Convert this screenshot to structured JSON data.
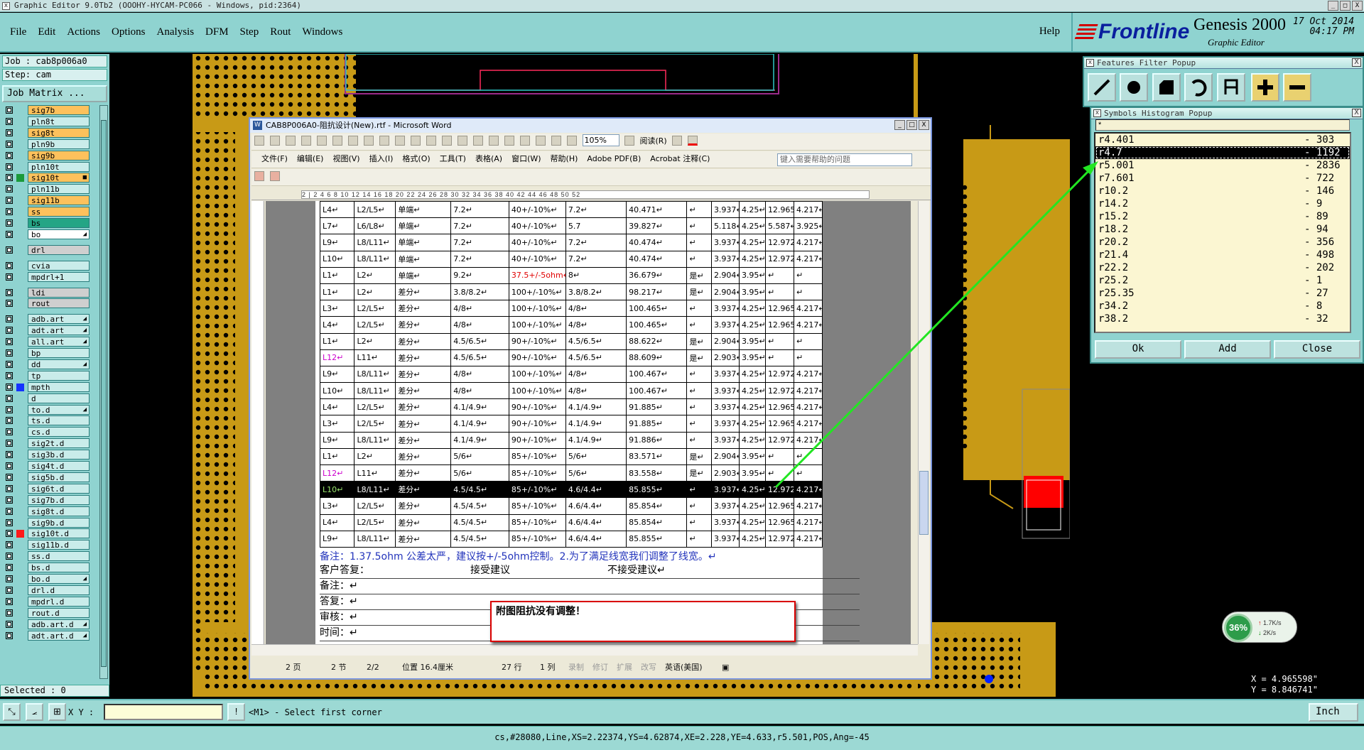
{
  "app": {
    "title": "Graphic Editor 9.0Tb2 (OOOHY-HYCAM-PC066 - Windows, pid:2364)",
    "window_buttons": [
      "_",
      "□",
      "X"
    ]
  },
  "menu": {
    "items": [
      "File",
      "Edit",
      "Actions",
      "Options",
      "Analysis",
      "DFM",
      "Step",
      "Rout",
      "Windows"
    ],
    "help": "Help"
  },
  "brand": {
    "logo": "Frontline",
    "product": "Genesis 2000",
    "sub": "Graphic Editor",
    "date": "17 Oct 2014",
    "time": "04:17 PM"
  },
  "left": {
    "job": "Job : cab8p006a0",
    "step": "Step: cam",
    "job_matrix": "Job Matrix ...",
    "selected": "Selected : 0",
    "layers": [
      {
        "name": "sig7b",
        "style": "sig"
      },
      {
        "name": "pln8t",
        "style": ""
      },
      {
        "name": "sig8t",
        "style": "sig"
      },
      {
        "name": "pln9b",
        "style": ""
      },
      {
        "name": "sig9b",
        "style": "sig"
      },
      {
        "name": "pln10t",
        "style": ""
      },
      {
        "name": "sig10t",
        "style": "sig",
        "mark": "■",
        "dot": "#1a9a3a"
      },
      {
        "name": "pln11b",
        "style": ""
      },
      {
        "name": "sig11b",
        "style": "sig"
      },
      {
        "name": "ss",
        "style": "sig"
      },
      {
        "name": "bs",
        "style": "green"
      },
      {
        "name": "bo",
        "style": "white",
        "mark": "◢"
      },
      {
        "name": "drl",
        "style": "gray"
      },
      {
        "name": "cvia",
        "style": ""
      },
      {
        "name": "mpdrl+1",
        "style": ""
      },
      {
        "name": "ldi",
        "style": "gray"
      },
      {
        "name": "rout",
        "style": "gray"
      },
      {
        "name": "adb.art",
        "style": "",
        "mark": "◢"
      },
      {
        "name": "adt.art",
        "style": "",
        "mark": "◢"
      },
      {
        "name": "all.art",
        "style": "",
        "mark": "◢"
      },
      {
        "name": "bp",
        "style": ""
      },
      {
        "name": "dd",
        "style": "",
        "mark": "◢"
      },
      {
        "name": "tp",
        "style": ""
      },
      {
        "name": "mpth",
        "style": "",
        "dot": "#1432ff"
      },
      {
        "name": "d",
        "style": ""
      },
      {
        "name": "to.d",
        "style": "",
        "mark": "◢"
      },
      {
        "name": "ts.d",
        "style": ""
      },
      {
        "name": "cs.d",
        "style": ""
      },
      {
        "name": "sig2t.d",
        "style": ""
      },
      {
        "name": "sig3b.d",
        "style": ""
      },
      {
        "name": "sig4t.d",
        "style": ""
      },
      {
        "name": "sig5b.d",
        "style": ""
      },
      {
        "name": "sig6t.d",
        "style": ""
      },
      {
        "name": "sig7b.d",
        "style": ""
      },
      {
        "name": "sig8t.d",
        "style": ""
      },
      {
        "name": "sig9b.d",
        "style": ""
      },
      {
        "name": "sig10t.d",
        "style": "",
        "dot": "#ff1a1a"
      },
      {
        "name": "sig11b.d",
        "style": ""
      },
      {
        "name": "ss.d",
        "style": ""
      },
      {
        "name": "bs.d",
        "style": ""
      },
      {
        "name": "bo.d",
        "style": "",
        "mark": "◢"
      },
      {
        "name": "drl.d",
        "style": ""
      },
      {
        "name": "mpdrl.d",
        "style": ""
      },
      {
        "name": "rout.d",
        "style": ""
      },
      {
        "name": "adb.art.d",
        "style": "",
        "mark": "◢"
      },
      {
        "name": "adt.art.d",
        "style": "",
        "mark": "◢"
      }
    ]
  },
  "bottom": {
    "xy_label": "X Y :",
    "xy_value": "",
    "message": "<M1> - Select first corner",
    "units": "Inch",
    "status": "cs,#28080,Line,XS=2.22374,YS=4.62874,XE=2.228,YE=4.633,r5.501,POS,Ang=-45"
  },
  "coords": {
    "x": "X = 4.965598\"",
    "y": "Y = 8.846741\""
  },
  "features_filter": {
    "title": "Features Filter Popup"
  },
  "histogram": {
    "title": "Symbols Histogram Popup",
    "filter": "*",
    "rows": [
      {
        "sym": "r4.401",
        "count": "- 303"
      },
      {
        "sym": "r4.7",
        "count": "- 1192"
      },
      {
        "sym": "r5.001",
        "count": "- 2836"
      },
      {
        "sym": "r7.601",
        "count": "- 722"
      },
      {
        "sym": "r10.2",
        "count": "- 146"
      },
      {
        "sym": "r14.2",
        "count": "- 9"
      },
      {
        "sym": "r15.2",
        "count": "- 89"
      },
      {
        "sym": "r18.2",
        "count": "- 94"
      },
      {
        "sym": "r20.2",
        "count": "- 356"
      },
      {
        "sym": "r21.4",
        "count": "- 498"
      },
      {
        "sym": "r22.2",
        "count": "- 202"
      },
      {
        "sym": "r25.2",
        "count": "- 1"
      },
      {
        "sym": "r25.35",
        "count": "- 27"
      },
      {
        "sym": "r34.2",
        "count": "- 8"
      },
      {
        "sym": "r38.2",
        "count": "- 32"
      }
    ],
    "ok": "Ok",
    "add": "Add",
    "close": "Close"
  },
  "word": {
    "title": "CAB8P006A0-阻抗设计(New).rtf - Microsoft Word",
    "menu": [
      "文件(F)",
      "编辑(E)",
      "视图(V)",
      "插入(I)",
      "格式(O)",
      "工具(T)",
      "表格(A)",
      "窗口(W)",
      "帮助(H)",
      "Adobe PDF(B)",
      "Acrobat 注释(C)"
    ],
    "help_box": "键入需要帮助的问题",
    "zoom": "105%",
    "read": "阅读(R)",
    "ruler": "2  |  2   4   6   8   10   12   14   16   18   20   22   24   26   28   30   32   34   36   38   40   42   44   46   48   50   52",
    "rows": [
      [
        "L4↵",
        "L2/L5↵",
        "单端↵",
        "7.2↵",
        "40+/-10%↵",
        "7.2↵",
        "40.471↵",
        "↵",
        "3.937↵",
        "4.25↵",
        "12.965↵",
        "4.217↵"
      ],
      [
        "L7↵",
        "L6/L8↵",
        "单端↵",
        "7.2↵",
        "40+/-10%↵",
        "5.7",
        "39.827↵",
        "↵",
        "5.118↵",
        "4.25↵",
        "5.587↵",
        "3.925↵"
      ],
      [
        "L9↵",
        "L8/L11↵",
        "单端↵",
        "7.2↵",
        "40+/-10%↵",
        "7.2↵",
        "40.474↵",
        "↵",
        "3.937↵",
        "4.25↵",
        "12.972↵",
        "4.217↵"
      ],
      [
        "L10↵",
        "L8/L11↵",
        "单端↵",
        "7.2↵",
        "40+/-10%↵",
        "7.2↵",
        "40.474↵",
        "↵",
        "3.937↵",
        "4.25↵",
        "12.972↵",
        "4.217↵"
      ],
      [
        "L1↵",
        "L2↵",
        "单端↵",
        "9.2↵",
        "37.5+/-5ohm↵",
        "8↵",
        "36.679↵",
        "是↵",
        "2.904↵",
        "3.95↵",
        "↵",
        "↵"
      ],
      [
        "L1↵",
        "L2↵",
        "差分↵",
        "3.8/8.2↵",
        "100+/-10%↵",
        "3.8/8.2↵",
        "98.217↵",
        "是↵",
        "2.904↵",
        "3.95↵",
        "↵",
        "↵"
      ],
      [
        "L3↵",
        "L2/L5↵",
        "差分↵",
        "4/8↵",
        "100+/-10%↵",
        "4/8↵",
        "100.465↵",
        "↵",
        "3.937↵",
        "4.25↵",
        "12.965↵",
        "4.217↵"
      ],
      [
        "L4↵",
        "L2/L5↵",
        "差分↵",
        "4/8↵",
        "100+/-10%↵",
        "4/8↵",
        "100.465↵",
        "↵",
        "3.937↵",
        "4.25↵",
        "12.965↵",
        "4.217↵"
      ],
      [
        "L1↵",
        "L2↵",
        "差分↵",
        "4.5/6.5↵",
        "90+/-10%↵",
        "4.5/6.5↵",
        "88.622↵",
        "是↵",
        "2.904↵",
        "3.95↵",
        "↵",
        "↵"
      ],
      [
        "L12↵",
        "L11↵",
        "差分↵",
        "4.5/6.5↵",
        "90+/-10%↵",
        "4.5/6.5↵",
        "88.609↵",
        "是↵",
        "2.903↵",
        "3.95↵",
        "↵",
        "↵"
      ],
      [
        "L9↵",
        "L8/L11↵",
        "差分↵",
        "4/8↵",
        "100+/-10%↵",
        "4/8↵",
        "100.467↵",
        "↵",
        "3.937↵",
        "4.25↵",
        "12.972↵",
        "4.217↵"
      ],
      [
        "L10↵",
        "L8/L11↵",
        "差分↵",
        "4/8↵",
        "100+/-10%↵",
        "4/8↵",
        "100.467↵",
        "↵",
        "3.937↵",
        "4.25↵",
        "12.972↵",
        "4.217↵"
      ],
      [
        "L4↵",
        "L2/L5↵",
        "差分↵",
        "4.1/4.9↵",
        "90+/-10%↵",
        "4.1/4.9↵",
        "91.885↵",
        "↵",
        "3.937↵",
        "4.25↵",
        "12.965↵",
        "4.217↵"
      ],
      [
        "L3↵",
        "L2/L5↵",
        "差分↵",
        "4.1/4.9↵",
        "90+/-10%↵",
        "4.1/4.9↵",
        "91.885↵",
        "↵",
        "3.937↵",
        "4.25↵",
        "12.965↵",
        "4.217↵"
      ],
      [
        "L9↵",
        "L8/L11↵",
        "差分↵",
        "4.1/4.9↵",
        "90+/-10%↵",
        "4.1/4.9↵",
        "91.886↵",
        "↵",
        "3.937↵",
        "4.25↵",
        "12.972↵",
        "4.217↵"
      ],
      [
        "L1↵",
        "L2↵",
        "差分↵",
        "5/6↵",
        "85+/-10%↵",
        "5/6↵",
        "83.571↵",
        "是↵",
        "2.904↵",
        "3.95↵",
        "↵",
        "↵"
      ],
      [
        "L12↵",
        "L11↵",
        "差分↵",
        "5/6↵",
        "85+/-10%↵",
        "5/6↵",
        "83.558↵",
        "是↵",
        "2.903↵",
        "3.95↵",
        "↵",
        "↵"
      ],
      [
        "L10↵",
        "L8/L11↵",
        "差分↵",
        "4.5/4.5↵",
        "85+/-10%↵",
        "4.6/4.4↵",
        "85.855↵",
        "↵",
        "3.937↵",
        "4.25↵",
        "12.972↵",
        "4.217↵"
      ],
      [
        "L3↵",
        "L2/L5↵",
        "差分↵",
        "4.5/4.5↵",
        "85+/-10%↵",
        "4.6/4.4↵",
        "85.854↵",
        "↵",
        "3.937↵",
        "4.25↵",
        "12.965↵",
        "4.217↵"
      ],
      [
        "L4↵",
        "L2/L5↵",
        "差分↵",
        "4.5/4.5↵",
        "85+/-10%↵",
        "4.6/4.4↵",
        "85.854↵",
        "↵",
        "3.937↵",
        "4.25↵",
        "12.965↵",
        "4.217↵"
      ],
      [
        "L9↵",
        "L8/L11↵",
        "差分↵",
        "4.5/4.5↵",
        "85+/-10%↵",
        "4.6/4.4↵",
        "85.855↵",
        "↵",
        "3.937↵",
        "4.25↵",
        "12.972↵",
        "4.217↵"
      ]
    ],
    "highlight_row": 17,
    "pink_rows": [
      9,
      16
    ],
    "red_cell": {
      "row": 4,
      "col": 4
    },
    "note": "备注：1.37.5ohm 公差太严，建议按+/-5ohm控制。2.为了满足线宽我们调整了线宽。↵",
    "reply_label": "客户答复：",
    "accept": "接受建议",
    "reject": "不接受建议↵",
    "remark": "备注：↵",
    "answer": "答复：↵",
    "review": "审核：↵",
    "time": "时间：↵",
    "callout": "附图阻抗没有调整！",
    "status": {
      "page": "2 页",
      "section": "2 节",
      "pages": "2/2",
      "pos": "位置 16.4厘米",
      "line": "27 行",
      "col": "1 列",
      "rec": "录制",
      "trk": "修订",
      "ext": "扩展",
      "ovr": "改写",
      "lang": "英语(美国)"
    }
  },
  "net": {
    "pct": "36%",
    "up": "1.7K/s",
    "down": "2K/s"
  }
}
